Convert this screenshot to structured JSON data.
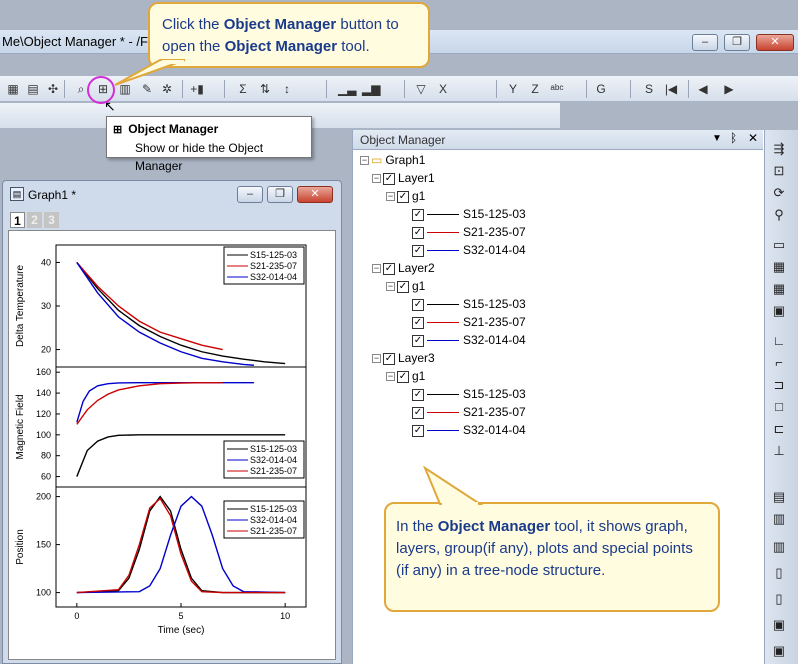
{
  "app": {
    "title": "Me\\Object Manager * - /Fo"
  },
  "callouts": {
    "top": {
      "pre": "Click the ",
      "bold1": "Object Manager",
      "mid": " button to open the ",
      "bold2": "Object Manager",
      "post": " tool."
    },
    "bottom": {
      "pre": "In the ",
      "bold": "Object Manager",
      "post": " tool, it shows graph, layers, group(if any), plots and special points (if any) in a tree-node structure."
    }
  },
  "tooltip": {
    "title": "Object Manager",
    "description": "Show or hide the Object Manager"
  },
  "graph_window": {
    "title": "Graph1 *",
    "layer_tabs": [
      "1",
      "2",
      "3"
    ],
    "x_axis_label": "Time (sec)"
  },
  "object_manager": {
    "title": "Object Manager",
    "root": "Graph1",
    "layers": [
      {
        "name": "Layer1",
        "group": "g1",
        "plots": [
          {
            "name": "S15-125-03",
            "color": "#000000"
          },
          {
            "name": "S21-235-07",
            "color": "#cc0000"
          },
          {
            "name": "S32-014-04",
            "color": "#0000cc"
          }
        ]
      },
      {
        "name": "Layer2",
        "group": "g1",
        "plots": [
          {
            "name": "S15-125-03",
            "color": "#000000"
          },
          {
            "name": "S21-235-07",
            "color": "#cc0000"
          },
          {
            "name": "S32-014-04",
            "color": "#0000cc"
          }
        ]
      },
      {
        "name": "Layer3",
        "group": "g1",
        "plots": [
          {
            "name": "S15-125-03",
            "color": "#000000"
          },
          {
            "name": "S21-235-07",
            "color": "#cc0000"
          },
          {
            "name": "S32-014-04",
            "color": "#0000cc"
          }
        ]
      }
    ]
  },
  "toolbar_icons": [
    "new-project-icon",
    "open-icon",
    "pan-icon",
    "zoom-icon",
    "object-manager-icon",
    "worksheet-icon",
    "notes-icon",
    "settings-icon",
    "add-column-icon",
    "sum-icon",
    "sort-icon",
    "sort-asc-icon",
    "bar-chart-icon",
    "column-chart-icon",
    "filter-icon",
    "x-icon",
    "y-icon",
    "z-icon",
    "label-icon",
    "g-icon",
    "s-icon",
    "first-icon",
    "prev-icon",
    "next-icon"
  ],
  "chart_data": [
    {
      "type": "line",
      "ylabel": "Delta Temperature",
      "ylim": [
        16,
        44
      ],
      "yticks": [
        20,
        30,
        40
      ],
      "xlim": [
        -1,
        11
      ],
      "series": [
        {
          "name": "S15-125-03",
          "color": "#000000",
          "x": [
            0,
            1,
            2,
            3,
            4,
            5,
            6,
            7,
            8,
            9,
            10
          ],
          "values": [
            40,
            34,
            29,
            25.5,
            23,
            21,
            19.5,
            18.5,
            17.8,
            17.2,
            16.8
          ]
        },
        {
          "name": "S21-235-07",
          "color": "#cc0000",
          "x": [
            0,
            1,
            2,
            3,
            4,
            5,
            6,
            7
          ],
          "values": [
            40,
            34.5,
            30,
            26.5,
            24,
            22.5,
            21,
            20
          ]
        },
        {
          "name": "S32-014-04",
          "color": "#0000cc",
          "x": [
            0,
            1,
            2,
            3,
            4,
            5,
            6,
            7,
            8,
            8.5
          ],
          "values": [
            40,
            33,
            27.5,
            24,
            21.5,
            19.5,
            18,
            17.2,
            16.6,
            16.4
          ]
        }
      ]
    },
    {
      "type": "line",
      "ylabel": "Magnetic Field",
      "ylim": [
        50,
        165
      ],
      "yticks": [
        60,
        80,
        100,
        120,
        140,
        160
      ],
      "xlim": [
        -1,
        11
      ],
      "series": [
        {
          "name": "S15-125-03",
          "color": "#000000",
          "x": [
            0,
            0.5,
            1,
            1.5,
            2,
            3,
            4,
            5,
            6,
            8,
            10
          ],
          "values": [
            60,
            85,
            94,
            98,
            99.5,
            100,
            100,
            100,
            100,
            100,
            100
          ]
        },
        {
          "name": "S32-014-04",
          "color": "#0000cc",
          "x": [
            0,
            0.3,
            0.6,
            1,
            1.5,
            2,
            3,
            4,
            6,
            8.5
          ],
          "values": [
            112,
            132,
            142,
            147,
            149,
            149.7,
            150,
            150,
            150,
            150
          ]
        },
        {
          "name": "S21-235-07",
          "color": "#cc0000",
          "x": [
            0,
            0.5,
            1,
            1.5,
            2,
            3,
            4,
            5,
            6,
            7
          ],
          "values": [
            110,
            124,
            133,
            139,
            143,
            147,
            149,
            149.6,
            150,
            150
          ]
        }
      ]
    },
    {
      "type": "line",
      "ylabel": "Position",
      "xlabel": "Time (sec)",
      "ylim": [
        85,
        210
      ],
      "yticks": [
        100,
        150,
        200
      ],
      "xlim": [
        -1,
        11
      ],
      "xticks": [
        0,
        5,
        10
      ],
      "series": [
        {
          "name": "S15-125-03",
          "color": "#000000",
          "x": [
            0,
            2,
            2.5,
            3,
            3.5,
            4,
            4.5,
            5,
            5.5,
            6,
            7,
            10
          ],
          "values": [
            100,
            102,
            115,
            145,
            185,
            200,
            185,
            145,
            115,
            102,
            100,
            100
          ]
        },
        {
          "name": "S32-014-04",
          "color": "#0000cc",
          "x": [
            0,
            3,
            3.5,
            4,
            4.5,
            5,
            5.5,
            6,
            6.5,
            7,
            7.5,
            8,
            10
          ],
          "values": [
            100,
            101,
            107,
            125,
            160,
            190,
            200,
            190,
            160,
            125,
            107,
            101,
            100
          ]
        },
        {
          "name": "S21-235-07",
          "color": "#cc0000",
          "x": [
            0,
            2,
            2.5,
            3,
            3.5,
            4,
            4.5,
            5,
            5.5,
            6,
            7,
            10
          ],
          "values": [
            100,
            103,
            118,
            150,
            188,
            198,
            180,
            140,
            112,
            101,
            100,
            100
          ]
        }
      ]
    }
  ]
}
